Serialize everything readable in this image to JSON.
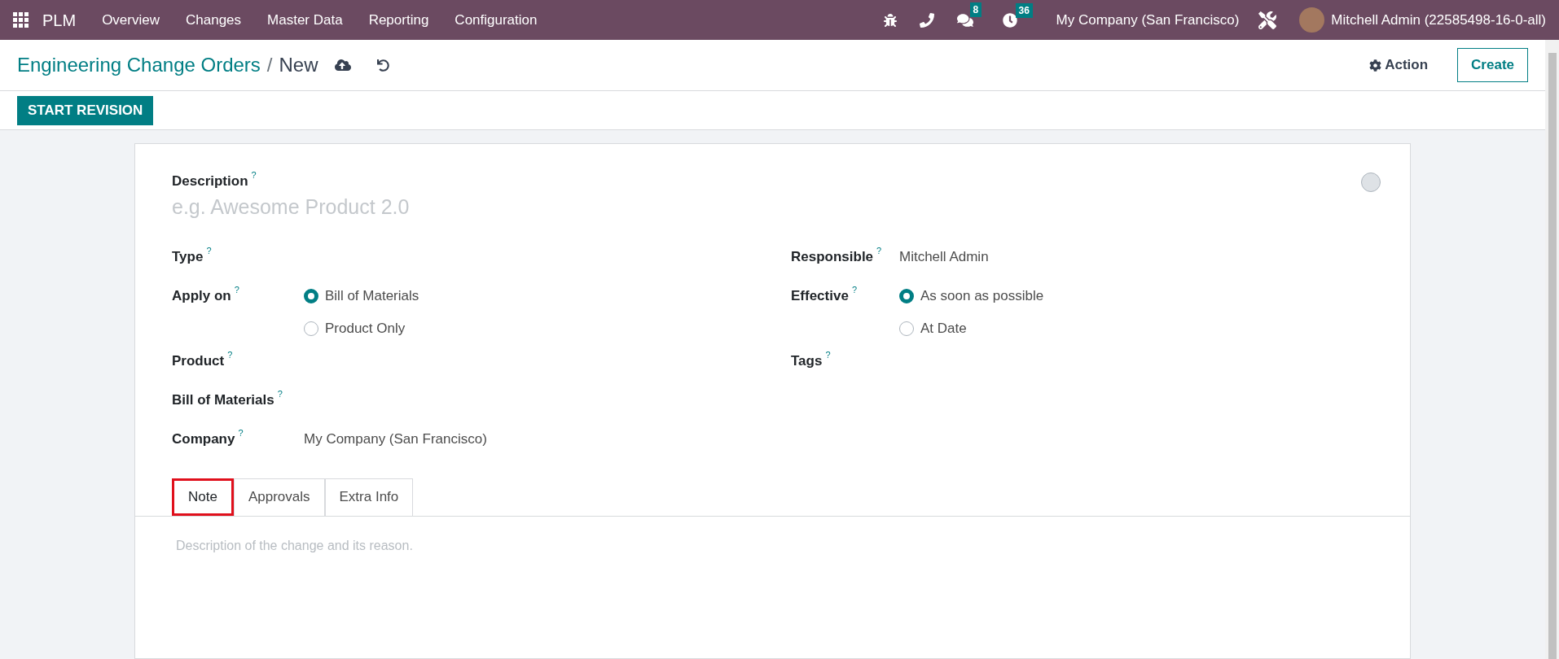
{
  "navbar": {
    "app_name": "PLM",
    "menu": [
      "Overview",
      "Changes",
      "Master Data",
      "Reporting",
      "Configuration"
    ],
    "messages_count": "8",
    "activities_count": "36",
    "company": "My Company (San Francisco)",
    "user": "Mitchell Admin (22585498-16-0-all)"
  },
  "breadcrumb": {
    "parent": "Engineering Change Orders",
    "separator": "/",
    "current": "New"
  },
  "actions": {
    "action": "Action",
    "create": "Create"
  },
  "status_button": "START REVISION",
  "form": {
    "description_label": "Description",
    "description_placeholder": "e.g. Awesome Product 2.0",
    "help_mark": "?",
    "left": [
      {
        "label": "Type",
        "kind": "empty"
      },
      {
        "label": "Apply on",
        "kind": "radio",
        "options": [
          {
            "label": "Bill of Materials",
            "selected": true
          },
          {
            "label": "Product Only",
            "selected": false
          }
        ]
      },
      {
        "label": "Product",
        "kind": "empty"
      },
      {
        "label": "Bill of Materials",
        "kind": "empty"
      },
      {
        "label": "Company",
        "kind": "text",
        "value": "My Company (San Francisco)"
      }
    ],
    "right": [
      {
        "label": "Responsible",
        "kind": "text",
        "value": "Mitchell Admin"
      },
      {
        "label": "Effective",
        "kind": "radio",
        "options": [
          {
            "label": "As soon as possible",
            "selected": true
          },
          {
            "label": "At Date",
            "selected": false
          }
        ]
      },
      {
        "label": "Tags",
        "kind": "empty"
      }
    ],
    "tabs": [
      {
        "label": "Note",
        "selected": true,
        "highlighted": true
      },
      {
        "label": "Approvals",
        "selected": false,
        "highlighted": false
      },
      {
        "label": "Extra Info",
        "selected": false,
        "highlighted": false
      }
    ],
    "note_placeholder": "Description of the change and its reason."
  }
}
